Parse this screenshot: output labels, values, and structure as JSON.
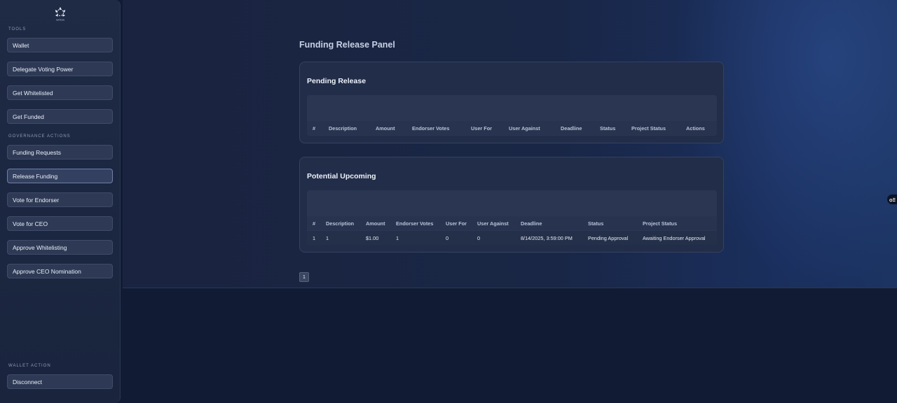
{
  "sidebar": {
    "logo_text": "NATION",
    "sections": {
      "tools": "TOOLS",
      "governance": "GOVERNANCE ACTIONS",
      "wallet_action": "WALLET ACTION"
    },
    "tools": [
      {
        "label": "Wallet"
      },
      {
        "label": "Delegate Voting Power"
      },
      {
        "label": "Get Whitelisted"
      },
      {
        "label": "Get Funded"
      }
    ],
    "governance": [
      {
        "label": "Funding Requests"
      },
      {
        "label": "Release Funding",
        "active": true
      },
      {
        "label": "Vote for Endorser"
      },
      {
        "label": "Vote for CEO"
      },
      {
        "label": "Approve Whitelisting"
      },
      {
        "label": "Approve CEO Nomination"
      }
    ],
    "disconnect": "Disconnect"
  },
  "main": {
    "title": "Funding Release Panel",
    "pending": {
      "title": "Pending Release",
      "columns": [
        "#",
        "Description",
        "Amount",
        "Endorser Votes",
        "User For",
        "User Against",
        "Deadline",
        "Status",
        "Project Status",
        "Actions"
      ]
    },
    "upcoming": {
      "title": "Potential Upcoming",
      "columns": [
        "#",
        "Description",
        "Amount",
        "Endorser Votes",
        "User For",
        "User Against",
        "Deadline",
        "Status",
        "Project Status"
      ],
      "rows": [
        [
          "1",
          "1",
          "$1.00",
          "1",
          "0",
          "0",
          "8/14/2025, 3:59:00 PM",
          "Pending Approval",
          "Awaiting Endorser Approval"
        ]
      ]
    },
    "pagination": {
      "current": "1"
    }
  },
  "colors": {
    "background": "#111b33",
    "sidebar": "#1f2a44",
    "card": "#222d49",
    "button": "#2e3a55"
  }
}
